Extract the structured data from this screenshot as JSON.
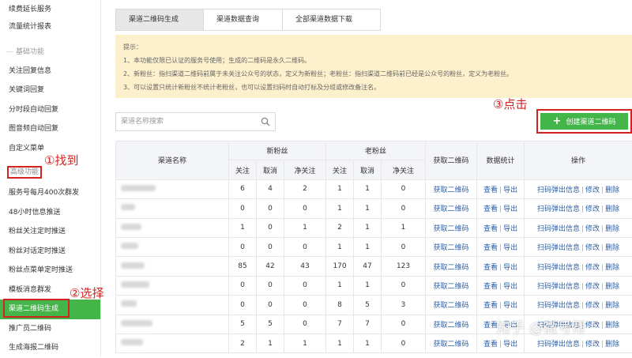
{
  "sidebar": {
    "items": [
      {
        "label": "续费延长服务"
      },
      {
        "label": "流量统计报表"
      },
      {
        "label": "基础功能"
      },
      {
        "label": "关注回复信息"
      },
      {
        "label": "关键词回复"
      },
      {
        "label": "分时段自动回复"
      },
      {
        "label": "图音频自动回复"
      },
      {
        "label": "自定义菜单"
      },
      {
        "label": "高级功能"
      },
      {
        "label": "服务号每月400次群发"
      },
      {
        "label": "48小时信息推送"
      },
      {
        "label": "粉丝关注定时推送"
      },
      {
        "label": "粉丝对话定时推送"
      },
      {
        "label": "粉丝点菜单定时推送"
      },
      {
        "label": "模板消息群发"
      },
      {
        "label": "渠道二维码生成"
      },
      {
        "label": "推广员二维码"
      },
      {
        "label": "生成海报二维码"
      }
    ]
  },
  "annotations": {
    "find": "①找到",
    "select": "②选择",
    "click": "③点击"
  },
  "tabs": [
    {
      "label": "渠道二维码生成"
    },
    {
      "label": "渠道数据查询"
    },
    {
      "label": "全部渠道数据下载"
    }
  ],
  "notice": {
    "title": "提示：",
    "lines": [
      "1、本功能仅限已认证的服务号使用；生成的二维码是永久二维码。",
      "2、新粉丝：指扫渠道二维码前属于未关注公众号的状态，定义为新粉丝；老粉丝：指扫渠道二维码前已经是公众号的粉丝，定义为老粉丝。",
      "3、可以设置只统计新粉丝不统计老粉丝，也可以设置扫码时自动打标及分组或修改备注名。"
    ]
  },
  "search": {
    "placeholder": "渠道名称搜索"
  },
  "create_button": {
    "label": "创建渠道二维码"
  },
  "table": {
    "headers": {
      "name": "渠道名称",
      "new_fans": "新粉丝",
      "old_fans": "老粉丝",
      "get_qr": "获取二维码",
      "stats": "数据统计",
      "ops": "操作",
      "sub": [
        "关注",
        "取消",
        "净关注",
        "关注",
        "取消",
        "净关注"
      ]
    },
    "actions": {
      "get_qr": "获取二维码",
      "view": "查看",
      "export": "导出",
      "popup": "扫码弹出信息",
      "edit": "修改",
      "delete": "删除"
    },
    "rows": [
      {
        "v": [
          "6",
          "4",
          "2",
          "1",
          "1",
          "0"
        ]
      },
      {
        "v": [
          "0",
          "0",
          "0",
          "1",
          "1",
          "0"
        ]
      },
      {
        "v": [
          "1",
          "0",
          "1",
          "2",
          "1",
          "1"
        ]
      },
      {
        "v": [
          "0",
          "0",
          "0",
          "1",
          "1",
          "0"
        ]
      },
      {
        "v": [
          "85",
          "42",
          "43",
          "170",
          "47",
          "123"
        ]
      },
      {
        "v": [
          "0",
          "0",
          "0",
          "1",
          "1",
          "0"
        ]
      },
      {
        "v": [
          "0",
          "0",
          "0",
          "8",
          "5",
          "3"
        ]
      },
      {
        "v": [
          "5",
          "5",
          "0",
          "7",
          "7",
          "0"
        ]
      },
      {
        "v": [
          "2",
          "1",
          "1",
          "1",
          "1",
          "0"
        ]
      }
    ]
  },
  "watermark": "知乎 @微号帮",
  "colors": {
    "accent": "#44b549",
    "annotation": "#d32222",
    "link": "#2b5fa8",
    "notice_bg": "#fdf0cc"
  }
}
